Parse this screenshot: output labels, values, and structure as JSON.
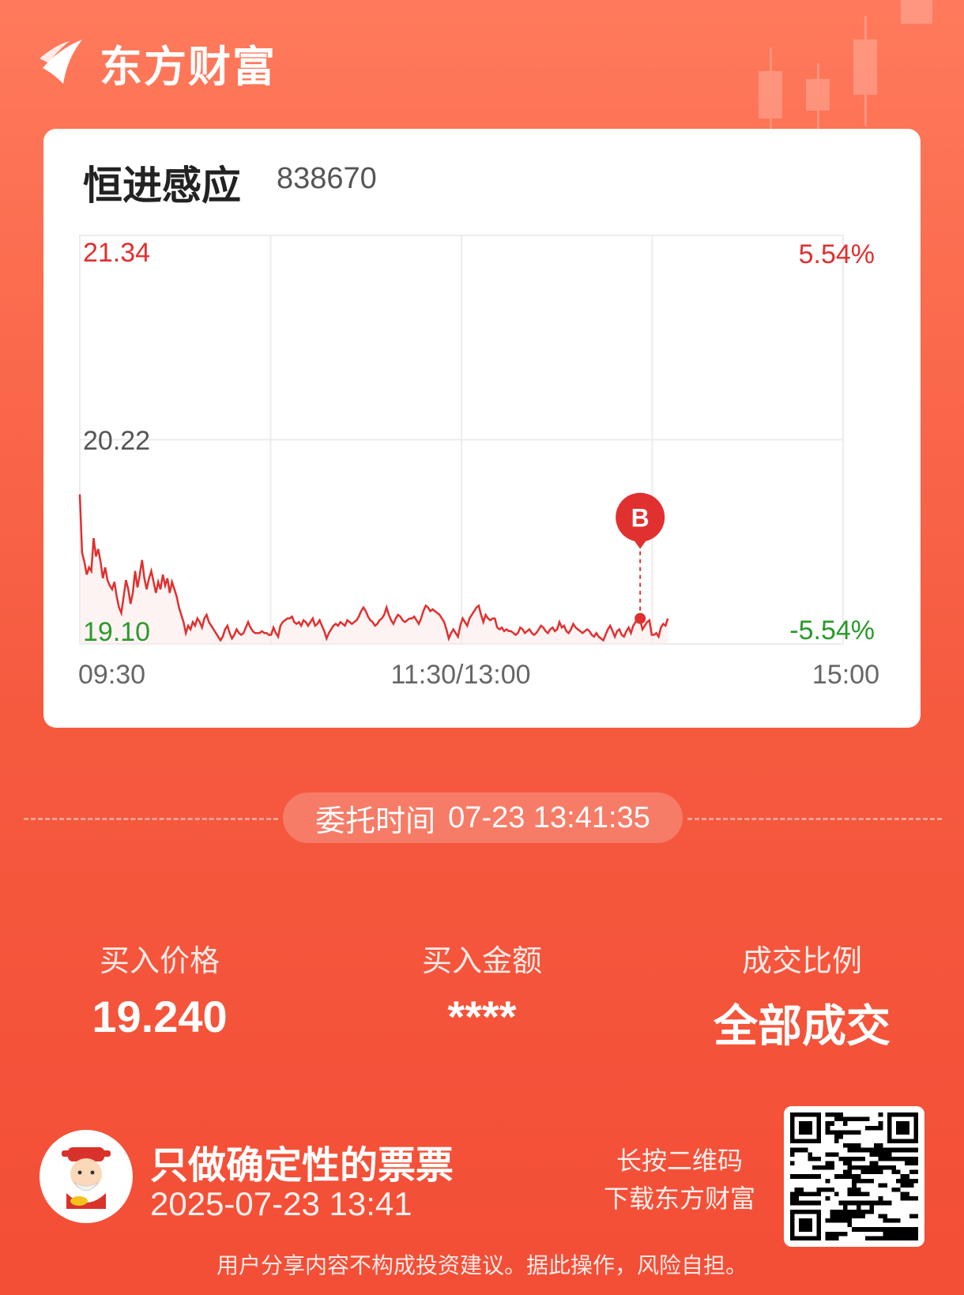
{
  "brand": {
    "name": "东方财富"
  },
  "stock": {
    "name": "恒进感应",
    "code": "838670"
  },
  "chart_data": {
    "type": "line",
    "y_labels": {
      "top": "21.34",
      "mid": "20.22",
      "bottom": "19.10"
    },
    "pct_labels": {
      "top": "5.54%",
      "bottom": "-5.54%"
    },
    "x_labels": [
      "09:30",
      "11:30/13:00",
      "15:00"
    ],
    "ylim": [
      19.1,
      21.34
    ],
    "prev_close": 20.22,
    "trade_marker": {
      "label": "B",
      "price": 19.24,
      "point_index": 243
    },
    "colors": {
      "line": "#e03030",
      "up": "#e03030",
      "down": "#2a9a2a",
      "neutral": "#555555",
      "grid": "#ececec"
    },
    "series": [
      {
        "values": [
          19.92,
          19.6,
          19.55,
          19.48,
          19.52,
          19.5,
          19.68,
          19.58,
          19.62,
          19.55,
          19.46,
          19.52,
          19.45,
          19.42,
          19.4,
          19.44,
          19.36,
          19.3,
          19.27,
          19.36,
          19.45,
          19.4,
          19.32,
          19.38,
          19.5,
          19.41,
          19.48,
          19.56,
          19.46,
          19.4,
          19.46,
          19.5,
          19.44,
          19.38,
          19.44,
          19.4,
          19.48,
          19.42,
          19.46,
          19.38,
          19.44,
          19.4,
          19.36,
          19.3,
          19.26,
          19.22,
          19.16,
          19.2,
          19.18,
          19.22,
          19.2,
          19.24,
          19.22,
          19.19,
          19.24,
          19.26,
          19.22,
          19.2,
          19.18,
          19.16,
          19.14,
          19.12,
          19.14,
          19.18,
          19.2,
          19.16,
          19.13,
          19.15,
          19.18,
          19.16,
          19.15,
          19.16,
          19.19,
          19.22,
          19.19,
          19.17,
          19.16,
          19.16,
          19.16,
          19.17,
          19.16,
          19.16,
          19.15,
          19.15,
          19.19,
          19.16,
          19.14,
          19.2,
          19.22,
          19.23,
          19.24,
          19.24,
          19.25,
          19.22,
          19.21,
          19.22,
          19.2,
          19.23,
          19.22,
          19.2,
          19.22,
          19.24,
          19.2,
          19.21,
          19.23,
          19.2,
          19.17,
          19.13,
          19.16,
          19.18,
          19.2,
          19.21,
          19.2,
          19.22,
          19.21,
          19.2,
          19.23,
          19.22,
          19.21,
          19.22,
          19.23,
          19.25,
          19.28,
          19.3,
          19.28,
          19.25,
          19.23,
          19.22,
          19.2,
          19.21,
          19.23,
          19.24,
          19.26,
          19.3,
          19.26,
          19.23,
          19.21,
          19.24,
          19.26,
          19.25,
          19.23,
          19.22,
          19.23,
          19.24,
          19.24,
          19.25,
          19.23,
          19.21,
          19.24,
          19.28,
          19.31,
          19.3,
          19.28,
          19.29,
          19.28,
          19.27,
          19.26,
          19.24,
          19.22,
          19.18,
          19.13,
          19.16,
          19.18,
          19.16,
          19.14,
          19.2,
          19.24,
          19.22,
          19.2,
          19.24,
          19.26,
          19.28,
          19.3,
          19.31,
          19.26,
          19.22,
          19.26,
          19.24,
          19.23,
          19.24,
          19.24,
          19.19,
          19.18,
          19.19,
          19.17,
          19.18,
          19.17,
          19.17,
          19.16,
          19.15,
          19.16,
          19.19,
          19.18,
          19.16,
          19.17,
          19.18,
          19.16,
          19.15,
          19.16,
          19.18,
          19.2,
          19.19,
          19.17,
          19.16,
          19.18,
          19.19,
          19.17,
          19.18,
          19.22,
          19.19,
          19.2,
          19.17,
          19.16,
          19.18,
          19.21,
          19.19,
          19.18,
          19.17,
          19.16,
          19.17,
          19.18,
          19.17,
          19.15,
          19.14,
          19.16,
          19.14,
          19.13,
          19.12,
          19.15,
          19.18,
          19.2,
          19.17,
          19.14,
          19.17,
          19.18,
          19.15,
          19.14,
          19.17,
          19.19,
          19.16,
          19.2,
          19.22,
          19.24,
          19.23,
          19.18,
          19.2,
          19.22,
          19.23,
          19.15,
          19.15,
          19.16,
          19.14,
          19.19,
          19.21,
          19.2,
          19.24
        ]
      }
    ]
  },
  "order_time": {
    "label": "委托时间",
    "value": "07-23 13:41:35"
  },
  "stats": [
    {
      "label": "买入价格",
      "value": "19.240"
    },
    {
      "label": "买入金额",
      "value": "****"
    },
    {
      "label": "成交比例",
      "value": "全部成交"
    }
  ],
  "footer": {
    "slogan": "只做确定性的票票",
    "datetime": "2025-07-23 13:41",
    "qr_hint_line1": "长按二维码",
    "qr_hint_line2": "下载东方财富",
    "disclaimer": "用户分享内容不构成投资建议。据此操作，风险自担。",
    "avatar_icon": "fortune-god-avatar-icon",
    "qr_icon": "qr-code-icon"
  }
}
